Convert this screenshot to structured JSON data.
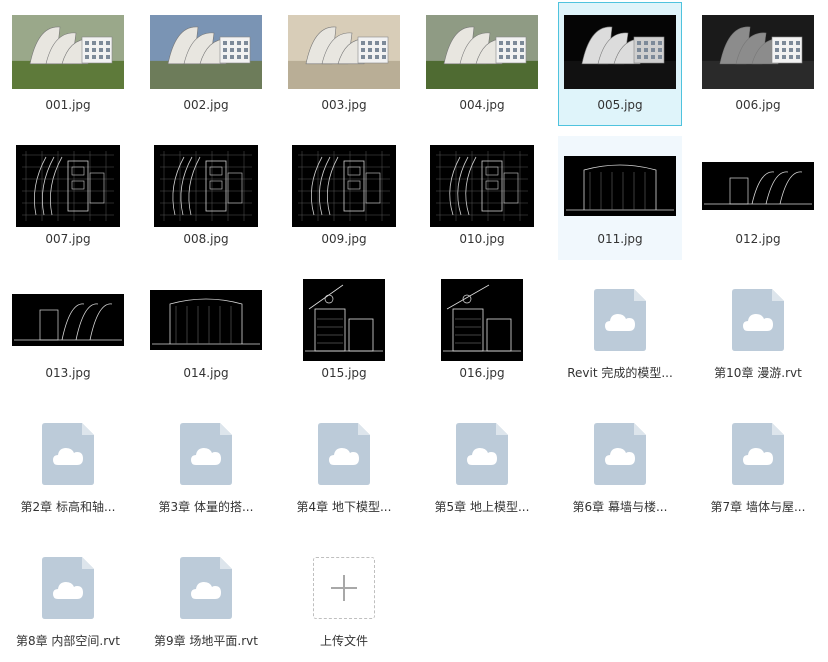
{
  "files": [
    {
      "name": "001.jpg",
      "type": "render",
      "variant": 0
    },
    {
      "name": "002.jpg",
      "type": "render",
      "variant": 1
    },
    {
      "name": "003.jpg",
      "type": "render",
      "variant": 2
    },
    {
      "name": "004.jpg",
      "type": "render",
      "variant": 3
    },
    {
      "name": "005.jpg",
      "type": "render",
      "variant": 4,
      "selected": true
    },
    {
      "name": "006.jpg",
      "type": "render",
      "variant": 5
    },
    {
      "name": "007.jpg",
      "type": "drawing",
      "variant": 0
    },
    {
      "name": "008.jpg",
      "type": "drawing",
      "variant": 1
    },
    {
      "name": "009.jpg",
      "type": "drawing",
      "variant": 2
    },
    {
      "name": "010.jpg",
      "type": "drawing",
      "variant": 3
    },
    {
      "name": "011.jpg",
      "type": "elevation",
      "variant": 0,
      "hovered": true
    },
    {
      "name": "012.jpg",
      "type": "elevation",
      "variant": 1
    },
    {
      "name": "013.jpg",
      "type": "elevation",
      "variant": 2
    },
    {
      "name": "014.jpg",
      "type": "elevation",
      "variant": 3
    },
    {
      "name": "015.jpg",
      "type": "section",
      "variant": 0
    },
    {
      "name": "016.jpg",
      "type": "section",
      "variant": 1
    },
    {
      "name": "Revit 完成的模型...",
      "type": "cloud-file"
    },
    {
      "name": "第10章 漫游.rvt",
      "type": "cloud-file"
    },
    {
      "name": "第2章 标高和轴...",
      "type": "cloud-file"
    },
    {
      "name": "第3章 体量的搭...",
      "type": "cloud-file"
    },
    {
      "name": "第4章 地下模型...",
      "type": "cloud-file"
    },
    {
      "name": "第5章 地上模型...",
      "type": "cloud-file"
    },
    {
      "name": "第6章 幕墙与楼...",
      "type": "cloud-file"
    },
    {
      "name": "第7章 墙体与屋...",
      "type": "cloud-file"
    },
    {
      "name": "第8章 内部空间.rvt",
      "type": "cloud-file"
    },
    {
      "name": "第9章 场地平面.rvt",
      "type": "cloud-file"
    }
  ],
  "upload": {
    "label": "上传文件",
    "icon": "plus-icon"
  },
  "icons": {
    "cloud_file": "cloud-file-icon"
  },
  "colors": {
    "selected_bg": "#dff4fa",
    "selected_border": "#4fc3de",
    "hover_bg": "#f1f8fd",
    "file_icon": "#bccbd9",
    "file_icon_fold": "#dde5ec",
    "label_text": "#333333"
  }
}
